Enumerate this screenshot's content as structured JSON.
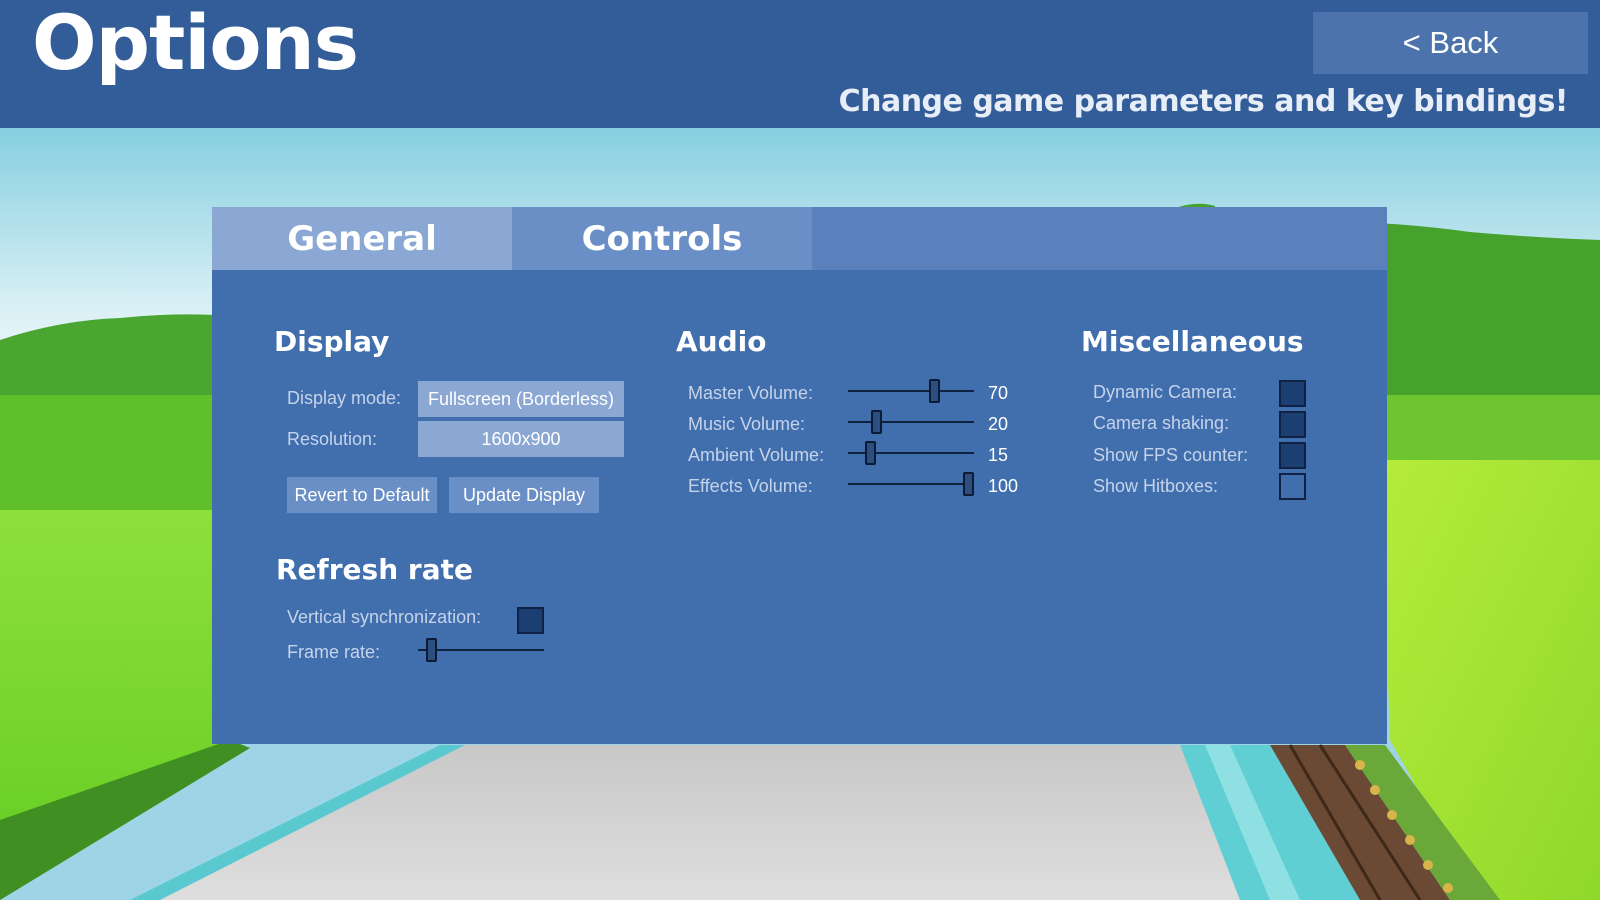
{
  "header": {
    "title": "Options",
    "back_label": "< Back",
    "subtitle": "Change game parameters and key bindings!"
  },
  "tabs": [
    {
      "label": "General",
      "active": true
    },
    {
      "label": "Controls",
      "active": false
    }
  ],
  "display": {
    "title": "Display",
    "mode_label": "Display mode:",
    "mode_value": "Fullscreen (Borderless)",
    "resolution_label": "Resolution:",
    "resolution_value": "1600x900",
    "revert_label": "Revert to Default",
    "update_label": "Update Display"
  },
  "refresh": {
    "title": "Refresh rate",
    "vsync_label": "Vertical synchronization:",
    "vsync_checked": true,
    "framerate_label": "Frame rate:",
    "framerate_level": 0.07
  },
  "audio": {
    "title": "Audio",
    "sliders": [
      {
        "label": "Master Volume:",
        "value": 70,
        "value_text": "70"
      },
      {
        "label": "Music Volume:",
        "value": 20,
        "value_text": "20"
      },
      {
        "label": "Ambient Volume:",
        "value": 15,
        "value_text": "15"
      },
      {
        "label": "Effects Volume:",
        "value": 100,
        "value_text": "100"
      }
    ]
  },
  "misc": {
    "title": "Miscellaneous",
    "options": [
      {
        "label": "Dynamic Camera:",
        "checked": true
      },
      {
        "label": "Camera shaking:",
        "checked": true
      },
      {
        "label": "Show FPS counter:",
        "checked": true
      },
      {
        "label": "Show Hitboxes:",
        "checked": false
      }
    ]
  },
  "colors": {
    "header_bg": "#335d99",
    "panel_bg": "#416fae",
    "tab_active": "#8aa8d3",
    "tab_inactive": "#6a8fc6",
    "checkbox_on": "#1c3f73"
  }
}
